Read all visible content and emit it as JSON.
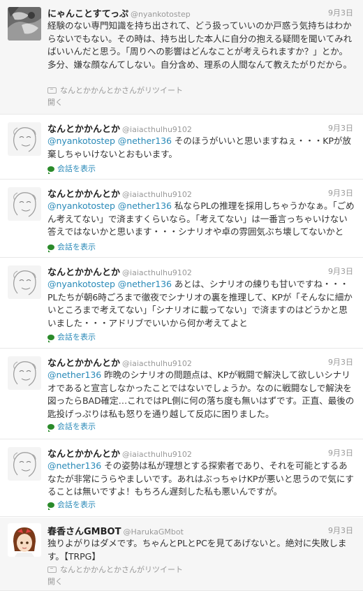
{
  "tweets": [
    {
      "name": "にゃんことすてっぷ",
      "handle": "@nyankotostep",
      "date": "9月3日",
      "text_plain": "経験のない専門知識を持ち出されて、どう扱っていいのか戸惑う気持ちはわからないでもない。その時は、持ち出した本人に自分の抱える疑問を聞いてみればいいんだと思う。「周りへの影響はどんなことが考えられますか？」とか。多分、嫌な顔なんてしない。自分含め、理系の人間なんて教えたがりだから。",
      "retweet_text": "なんとかかんとかさんがリツイート",
      "action": "開く",
      "avatar": "cat-photo-avatar"
    },
    {
      "name": "なんとかかんとか",
      "handle": "@iaiacthulhu9102",
      "date": "9月3日",
      "mentions": "@nyankotostep @nether136",
      "text_rest": "そのほうがいいと思いますねぇ・・・KPが放棄しちゃいけないとおもいます。",
      "conversation": "会話を表示",
      "avatar": "sketch-face-avatar"
    },
    {
      "name": "なんとかかんとか",
      "handle": "@iaiacthulhu9102",
      "date": "9月3日",
      "mentions": "@nyankotostep @nether136",
      "text_rest": "私ならPLの推理を採用しちゃうかなぁ。「ごめん考えてない」で済ますくらいなら。「考えてない」は一番言っちゃいけない答えではないかと思います・・・シナリオや卓の雰囲気ぶち壊してないかと",
      "conversation": "会話を表示",
      "avatar": "sketch-face-avatar"
    },
    {
      "name": "なんとかかんとか",
      "handle": "@iaiacthulhu9102",
      "date": "9月3日",
      "mentions": "@nyankotostep @nether136",
      "text_rest": "あとは、シナリオの練りも甘いですね・・・PLたちが朝6時ごろまで徹夜でシナリオの裏を推理して、KPが「そんなに細かいところまで考えてない」「シナリオに載ってない」で済ますのはどうかと思いました・・・アドリブでいいから何か考えてよと",
      "conversation": "会話を表示",
      "avatar": "sketch-face-avatar"
    },
    {
      "name": "なんとかかんとか",
      "handle": "@iaiacthulhu9102",
      "date": "9月3日",
      "mentions": "@nether136",
      "text_rest": "昨晩のシナリオの問題点は、KPが戦闘で解決して欲しいシナリオであると宣言しなかったことではないでしょうか。なのに戦闘なしで解決を図ったらBAD確定…これではPL側に何の落ち度も無いはずです。正直、最後の匙投げっぷりは私も怒りを通り越して反応に困りました。",
      "conversation": "会話を表示",
      "avatar": "sketch-face-avatar"
    },
    {
      "name": "なんとかかんとか",
      "handle": "@iaiacthulhu9102",
      "date": "9月3日",
      "mentions": "@nether136",
      "text_rest": "その姿勢は私が理想とする探索者であり、それを可能とするあなたが非常にうらやましいです。あれはぶっちゃけKPが悪いと思うので気にすることは無いですよ！もちろん遅刻した私も悪いんですが。",
      "conversation": "会話を表示",
      "avatar": "sketch-face-avatar"
    },
    {
      "name": "春香さんGMBOT",
      "handle": "@HarukaGMbot",
      "date": "9月3日",
      "text_plain": "独りよがりはダメです。ちゃんとPLとPCを見てあげないと。絶対に失敗します。【TRPG】",
      "retweet_text": "なんとかかんとかさんがリツイート",
      "action": "開く",
      "avatar": "anime-girl-avatar"
    }
  ]
}
